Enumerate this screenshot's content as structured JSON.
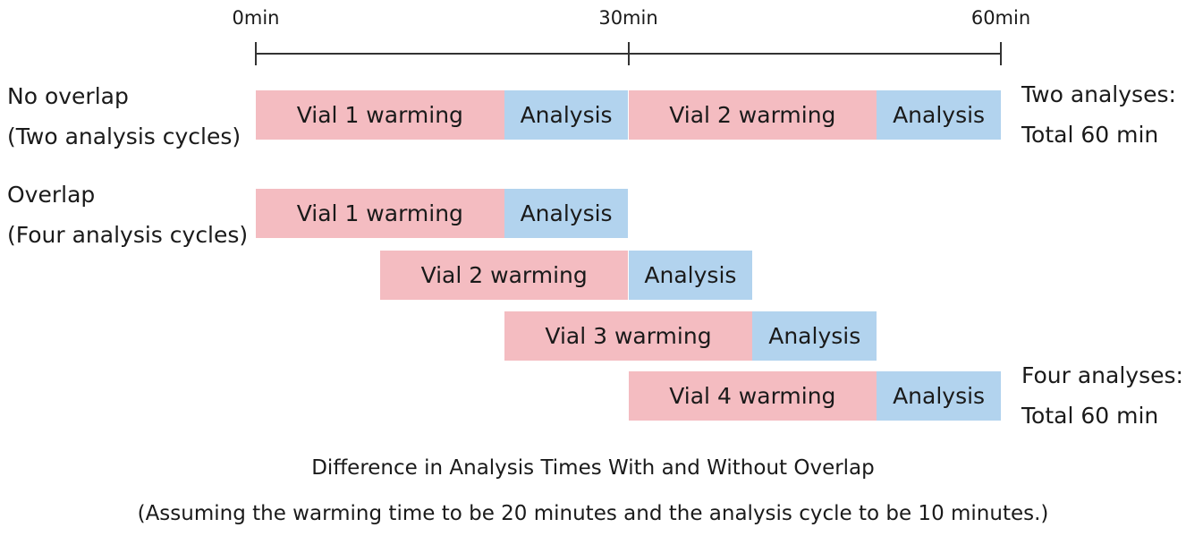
{
  "axis": {
    "ticks": [
      {
        "value": 0,
        "label": "0min"
      },
      {
        "value": 30,
        "label": "30min"
      },
      {
        "value": 60,
        "label": "60min"
      }
    ],
    "min": 0,
    "max": 60
  },
  "colors": {
    "warming": "#F4BCC1",
    "analysis": "#B2D3EE"
  },
  "groups": [
    {
      "label_line1": "No overlap",
      "label_line2": "(Two analysis cycles)",
      "note_line1": "Two analyses:",
      "note_line2": "Total 60 min"
    },
    {
      "label_line1": "Overlap",
      "label_line2": "(Four analysis cycles)",
      "note_line1": "Four analyses:",
      "note_line2": "Total 60 min"
    }
  ],
  "rows": [
    {
      "group": 0,
      "segments": [
        {
          "type": "warming",
          "label": "Vial 1 warming",
          "start": 0,
          "end": 20
        },
        {
          "type": "analysis",
          "label": "Analysis",
          "start": 20,
          "end": 30
        },
        {
          "type": "warming",
          "label": "Vial 2 warming",
          "start": 30,
          "end": 50
        },
        {
          "type": "analysis",
          "label": "Analysis",
          "start": 50,
          "end": 60
        }
      ]
    },
    {
      "group": 1,
      "segments": [
        {
          "type": "warming",
          "label": "Vial 1 warming",
          "start": 0,
          "end": 20
        },
        {
          "type": "analysis",
          "label": "Analysis",
          "start": 20,
          "end": 30
        }
      ]
    },
    {
      "group": 1,
      "segments": [
        {
          "type": "warming",
          "label": "Vial 2 warming",
          "start": 10,
          "end": 30
        },
        {
          "type": "analysis",
          "label": "Analysis",
          "start": 30,
          "end": 40
        }
      ]
    },
    {
      "group": 1,
      "segments": [
        {
          "type": "warming",
          "label": "Vial 3 warming",
          "start": 20,
          "end": 40
        },
        {
          "type": "analysis",
          "label": "Analysis",
          "start": 40,
          "end": 50
        }
      ]
    },
    {
      "group": 1,
      "segments": [
        {
          "type": "warming",
          "label": "Vial 4 warming",
          "start": 30,
          "end": 50
        },
        {
          "type": "analysis",
          "label": "Analysis",
          "start": 50,
          "end": 60
        }
      ]
    }
  ],
  "caption": {
    "title": "Difference in Analysis Times With and Without Overlap",
    "subtitle": "(Assuming the warming time to be 20 minutes and the analysis cycle to be 10 minutes.)"
  }
}
